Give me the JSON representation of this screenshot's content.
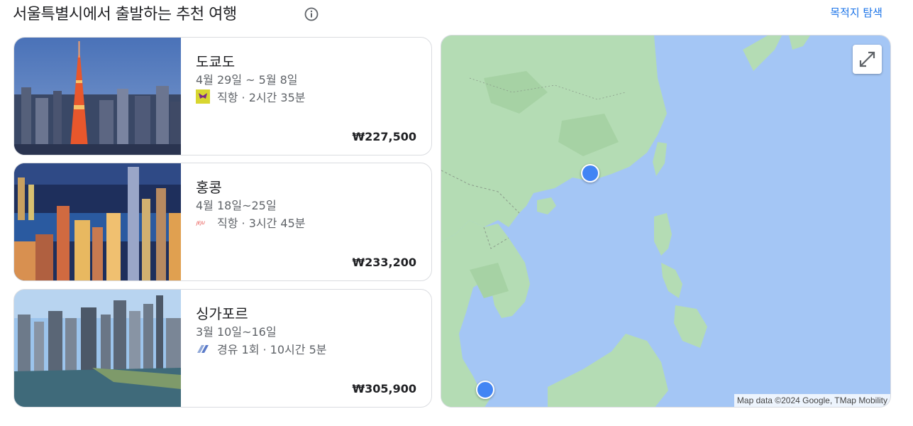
{
  "header": {
    "title": "서울특별시에서 출발하는 추천 여행",
    "explore_label": "목적지 탐색"
  },
  "destinations": [
    {
      "city": "도쿄도",
      "dates": "4월 29일 ~ 5월 8일",
      "flight": "직항 · 2시간 35분",
      "price": "₩227,500",
      "airline_icon": "airline-logo-icon"
    },
    {
      "city": "홍콩",
      "dates": "4월 18일~25일",
      "flight": "직항 · 3시간 45분",
      "price": "₩233,200",
      "airline_icon": "airline-logo-icon"
    },
    {
      "city": "싱가포르",
      "dates": "3월 10일~16일",
      "flight": "경유 1회 · 10시간 5분",
      "price": "₩305,900",
      "airline_icon": "airline-logo-icon"
    }
  ],
  "map": {
    "attribution": "Map data ©2024 Google, TMap Mobility",
    "water_color": "#a4c6f5",
    "land_color": "#b4dcb4",
    "pin_color": "#4285f4"
  }
}
